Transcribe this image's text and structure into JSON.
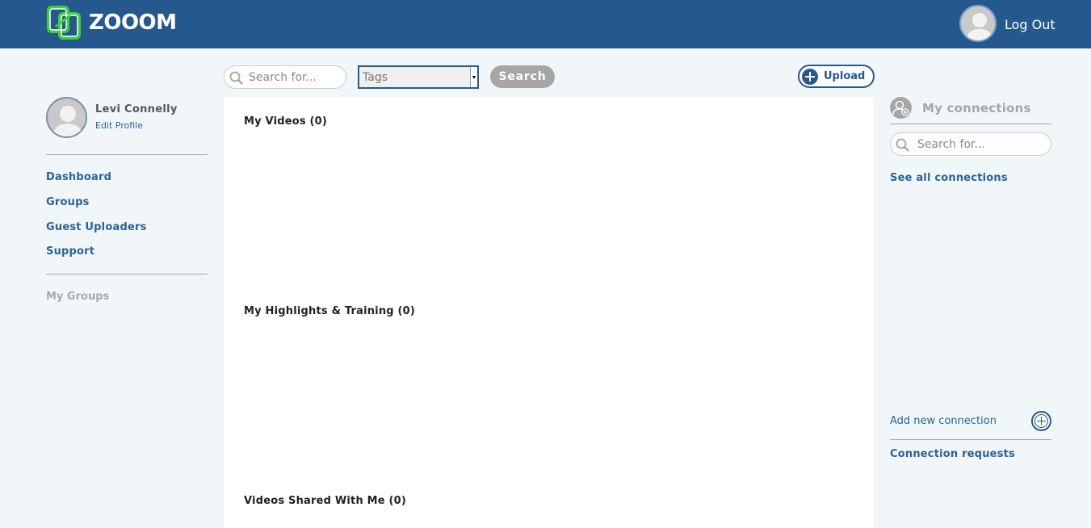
{
  "header": {
    "brand": "ZOOOM",
    "logout_label": "Log Out"
  },
  "profile": {
    "name": "Levi Connelly",
    "edit_label": "Edit Profile"
  },
  "sidebar": {
    "nav": [
      {
        "label": "Dashboard"
      },
      {
        "label": "Groups"
      },
      {
        "label": "Guest Uploaders"
      },
      {
        "label": "Support"
      }
    ],
    "my_groups_label": "My Groups"
  },
  "toolbar": {
    "search_placeholder": "Search for...",
    "tags_selected": "Tags",
    "search_label": "Search",
    "upload_label": "Upload"
  },
  "main": {
    "sections": [
      {
        "title": "My Videos (0)"
      },
      {
        "title": "My Highlights & Training (0)"
      },
      {
        "title": "Videos Shared With Me (0)"
      }
    ]
  },
  "connections": {
    "title": "My connections",
    "search_placeholder": "Search for...",
    "see_all_label": "See all connections",
    "add_label": "Add new connection",
    "requests_label": "Connection requests"
  },
  "colors": {
    "header_bg": "#25598e",
    "link": "#2a6496",
    "page_bg": "#f1f6f9",
    "logo_green": "#3ecf3e"
  }
}
